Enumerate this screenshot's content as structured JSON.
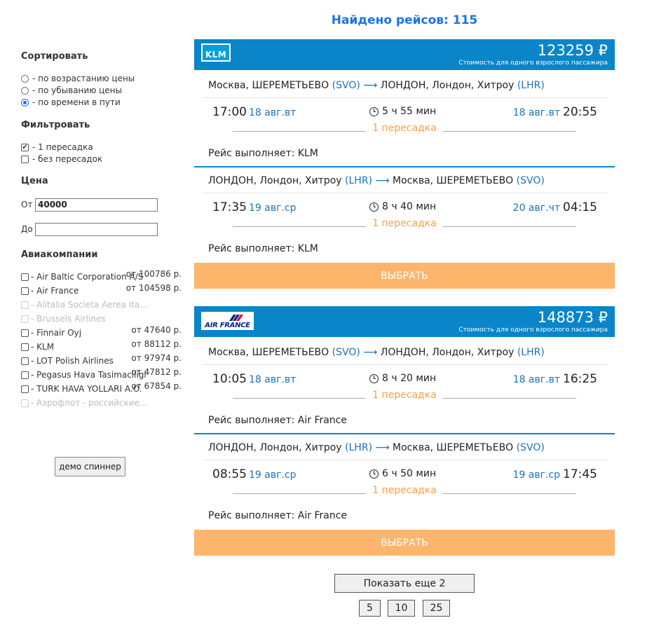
{
  "found": {
    "label": "Найдено рейсов: 115"
  },
  "sidebar": {
    "sort_title": "Сортировать",
    "sort_options": [
      "- по возрастанию цены",
      "- по убыванию цены",
      "- по времени в пути"
    ],
    "sort_selected": 2,
    "filter_title": "Фильтровать",
    "filter_options": [
      "- 1 пересадка",
      "- без пересадок"
    ],
    "price_title": "Цена",
    "price_from_label": "От",
    "price_from_value": "40000",
    "price_to_label": "До",
    "price_to_value": "",
    "airlines_title": "Авиакомпании",
    "airlines": [
      {
        "name": "- Air Baltic Corporation A/S",
        "price": "от 100786 р.",
        "disabled": false
      },
      {
        "name": "- Air France",
        "price": "от 104598 р.",
        "disabled": false
      },
      {
        "name": "- Alitalia Societa Aerea Italiana",
        "price": "",
        "disabled": true
      },
      {
        "name": "- Brussels Airlines",
        "price": "",
        "disabled": true
      },
      {
        "name": "- Finnair Oyj",
        "price": "от 47640 р.",
        "disabled": false
      },
      {
        "name": "- KLM",
        "price": "от 88112 р.",
        "disabled": false
      },
      {
        "name": "- LOT Polish Airlines",
        "price": "от 97974 р.",
        "disabled": false
      },
      {
        "name": "- Pegasus Hava Tasimaciligi",
        "price": "от 47812 р.",
        "disabled": false
      },
      {
        "name": "- TURK HAVA YOLLARI A.O.",
        "price": "от 67854 р.",
        "disabled": false
      },
      {
        "name": "- Аэрофлот - российские авиалинии",
        "price": "",
        "disabled": true
      }
    ],
    "spinner_button": "демо спиннер"
  },
  "cards": [
    {
      "airline_logo": "KLM",
      "price": "123259 ₽",
      "price_note": "Стоимость для одного взрослого пассажира",
      "legs": [
        {
          "route_from": "Москва, ШЕРЕМЕТЬЕВО",
          "from_code": "(SVO)",
          "arrow": "⟶",
          "route_to": "ЛОНДОН, Лондон, Хитроу",
          "to_code": "(LHR)",
          "dep_time": "17:00",
          "dep_date": "18 авг.вт",
          "duration": "5 ч 55 мин",
          "arr_date": "18 авг.вт",
          "arr_time": "20:55",
          "stops": "1 пересадка",
          "operator": "Рейс выполняет: KLM"
        },
        {
          "route_from": "ЛОНДОН, Лондон, Хитроу",
          "from_code": "(LHR)",
          "arrow": "⟶",
          "route_to": "Москва, ШЕРЕМЕТЬЕВО",
          "to_code": "(SVO)",
          "dep_time": "17:35",
          "dep_date": "19 авг.ср",
          "duration": "8 ч 40 мин",
          "arr_date": "20 авг.чт",
          "arr_time": "04:15",
          "stops": "1 пересадка",
          "operator": "Рейс выполняет: KLM"
        }
      ],
      "select": "ВЫБРАТЬ"
    },
    {
      "airline_logo": "AIR FRANCE",
      "price": "148873 ₽",
      "price_note": "Стоимость для одного взрослого пассажира",
      "legs": [
        {
          "route_from": "Москва, ШЕРЕМЕТЬЕВО",
          "from_code": "(SVO)",
          "arrow": "⟶",
          "route_to": "ЛОНДОН, Лондон, Хитроу",
          "to_code": "(LHR)",
          "dep_time": "10:05",
          "dep_date": "18 авг.вт",
          "duration": "8 ч 20 мин",
          "arr_date": "18 авг.вт",
          "arr_time": "16:25",
          "stops": "1 пересадка",
          "operator": "Рейс выполняет: Air France"
        },
        {
          "route_from": "ЛОНДОН, Лондон, Хитроу",
          "from_code": "(LHR)",
          "arrow": "⟶",
          "route_to": "Москва, ШЕРЕМЕТЬЕВО",
          "to_code": "(SVO)",
          "dep_time": "08:55",
          "dep_date": "19 авг.ср",
          "duration": "6 ч 50 мин",
          "arr_date": "19 авг.ср",
          "arr_time": "17:45",
          "stops": "1 пересадка",
          "operator": "Рейс выполняет: Air France"
        }
      ],
      "select": "ВЫБРАТЬ"
    }
  ],
  "pagination": {
    "show_more": "Показать еще  2",
    "sizes": [
      "5",
      "10",
      "25"
    ]
  },
  "colors": {
    "accent_blue": "#0a85c9",
    "select_orange": "#fdb56b",
    "stops_orange": "#f5a04a",
    "link_blue": "#1a73b8"
  },
  "icons": [
    "clock-icon",
    "route-arrow-icon",
    "klm-logo",
    "air-france-logo",
    "checkbox-icon",
    "radio-icon"
  ]
}
